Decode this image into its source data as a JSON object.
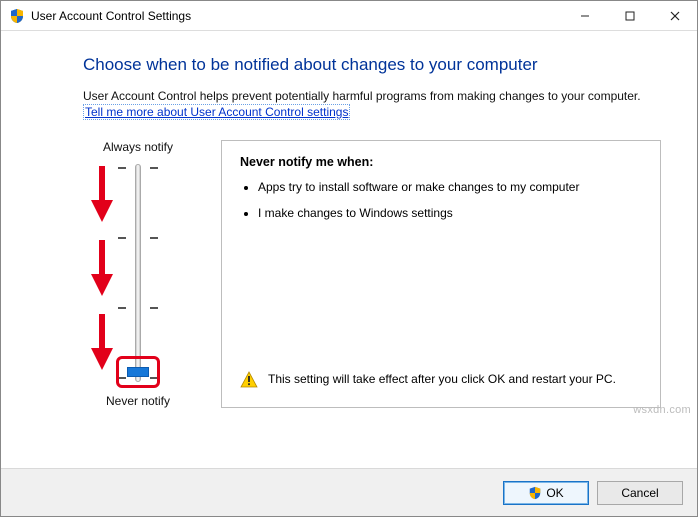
{
  "window": {
    "title": "User Account Control Settings"
  },
  "heading": "Choose when to be notified about changes to your computer",
  "description": "User Account Control helps prevent potentially harmful programs from making changes to your computer.",
  "help_link": "Tell me more about User Account Control settings",
  "slider": {
    "top_label": "Always notify",
    "bottom_label": "Never notify",
    "levels": 4,
    "current_level": 0
  },
  "panel": {
    "title": "Never notify me when:",
    "bullets": [
      "Apps try to install software or make changes to my computer",
      "I make changes to Windows settings"
    ],
    "warning": "This setting will take effect after you click OK and restart your PC."
  },
  "buttons": {
    "ok": "OK",
    "cancel": "Cancel"
  },
  "watermark": "wsxdn.com"
}
